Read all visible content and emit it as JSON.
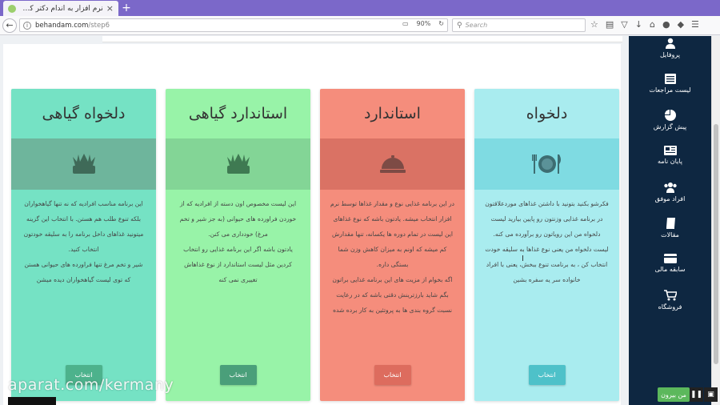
{
  "browser": {
    "tab_title": "نرم افزار به اندام دکتر کرمانی :",
    "new_tab": "+",
    "close": "×",
    "url_domain": "behandam.com",
    "url_path": "/step6",
    "zoom": "90%",
    "search_placeholder": "Search"
  },
  "cards": [
    {
      "title": "دلخواه گیاهی",
      "paragraphs": [
        "این برنامه مناسب افرادیه که نه تنها گیاهخواران بلکه تنوع طلب هم هستن. با انتخاب این گزینه میتونید غذاهای داخل برنامه را به سلیقه خودتون انتخاب کنید.",
        "شیر و تخم مرغ تنها فراورده های حیوانی هستن که توی لیست گیاهخواران دیده میشن"
      ],
      "button": "انتخاب"
    },
    {
      "title": "استاندارد گیاهی",
      "paragraphs": [
        "این لیست مخصوص اون دسته از افرادیه که از خوردن فراورده های حیوانی (به جز شیر و تخم مرغ) خودداری می کنن.",
        "یادتون باشه اگر این برنامه غذایی رو انتخاب کردین مثل لیست استاندارد از نوع غذاهاش تغییری نمی کنه"
      ],
      "button": "انتخاب"
    },
    {
      "title": "استاندارد",
      "paragraphs": [
        "در این برنامه غذایی نوع و مقدار غذاها توسط نرم افزار انتخاب میشه. یادتون باشه که نوع غذاهای این لیست در تمام دوره ها یکسانه، تنها مقدارش کم میشه که اونم به میزان کاهش وزن شما بستگی داره.",
        "اگه بخوام از مزیت های این برنامه غذایی براتون بگم شاید بارزترینش دقتی باشه که در رعایت نسبت گروه بندی ها به پروتئین به کار برده شده"
      ],
      "button": "انتخاب"
    },
    {
      "title": "دلخواه",
      "paragraphs": [
        "فکرشو بکنید بتونید با داشتن غذاهای موردعلاقتون در برنامه غذایی وزنتون رو پایین بیارید لیست دلخواه من این رویاتون رو برآورده می کنه.",
        "لیست دلخواه من یعنی نوع غذاها به سلیقه خودت انتخاب کن ، به برنامت تنوع ببخش، یعنی با افراد خانواده سر یه سفره بشین"
      ],
      "button": "انتخاب"
    }
  ],
  "sidebar": {
    "items": [
      {
        "label": "پروفایل",
        "icon": "user-icon"
      },
      {
        "label": "لیست مراجعات",
        "icon": "list-icon"
      },
      {
        "label": "پیش گزارش",
        "icon": "pie-chart-icon"
      },
      {
        "label": "پایان نامه",
        "icon": "newspaper-icon"
      },
      {
        "label": "افراد موفق",
        "icon": "users-icon"
      },
      {
        "label": "مقالات",
        "icon": "book-icon"
      },
      {
        "label": "سابقه مالی",
        "icon": "credit-card-icon"
      },
      {
        "label": "فروشگاه",
        "icon": "cart-icon"
      }
    ]
  },
  "overlay": {
    "watermark": "aparat.com/kermany",
    "player_button": "من بیرون"
  }
}
